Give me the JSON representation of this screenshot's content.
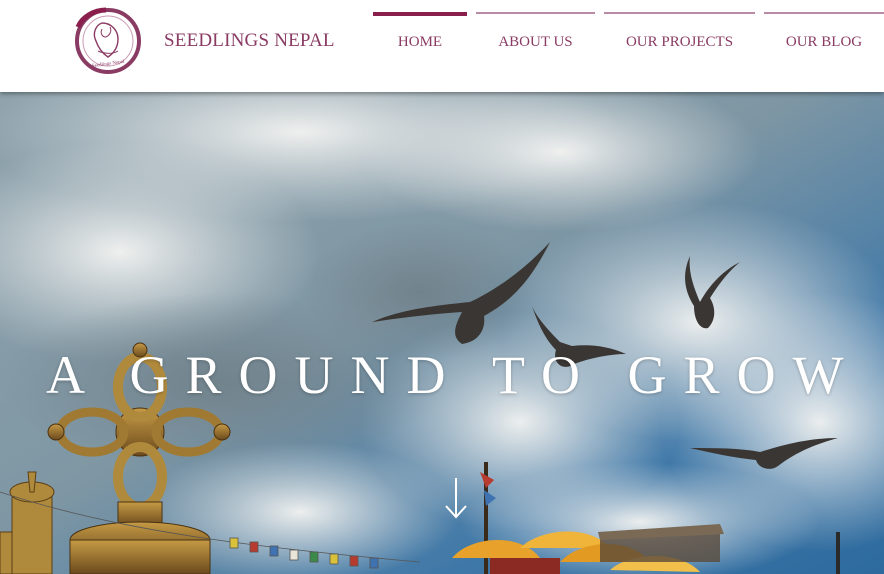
{
  "brand": {
    "name": "SEEDLINGS NEPAL",
    "logo_text": "Seedlings Nepal",
    "color": "#8a3b63"
  },
  "nav": {
    "items": [
      {
        "label": "HOME",
        "active": true
      },
      {
        "label": "ABOUT US",
        "active": false
      },
      {
        "label": "OUR PROJECTS",
        "active": false
      },
      {
        "label": "OUR BLOG",
        "active": false
      }
    ],
    "active_color": "#8a1f4e",
    "inactive_color": "#b98aa3"
  },
  "hero": {
    "headline": "A GROUND TO GROW",
    "scroll_icon": "arrow-down-icon"
  }
}
